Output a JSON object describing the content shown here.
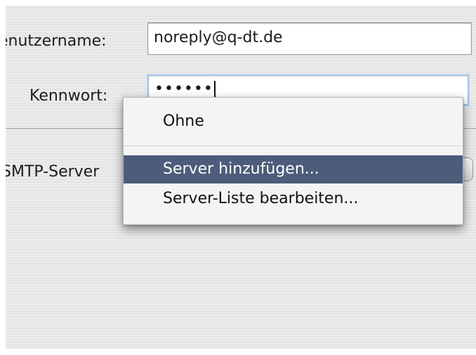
{
  "form": {
    "username_label": "enutzername:",
    "username_value": "noreply@q-dt.de",
    "password_label": "Kennwort:",
    "password_value": "••••••",
    "smtp_label": "SMTP-Server"
  },
  "smtp_menu": {
    "items": [
      {
        "label": "Ohne",
        "selected": false
      },
      {
        "label": "Server hinzufügen...",
        "selected": true
      },
      {
        "label": "Server-Liste bearbeiten...",
        "selected": false
      }
    ]
  },
  "colors": {
    "menu_highlight": "#4c5c7a",
    "window_background": "#e9e9e9",
    "focus_ring": "#a8c4e4"
  }
}
